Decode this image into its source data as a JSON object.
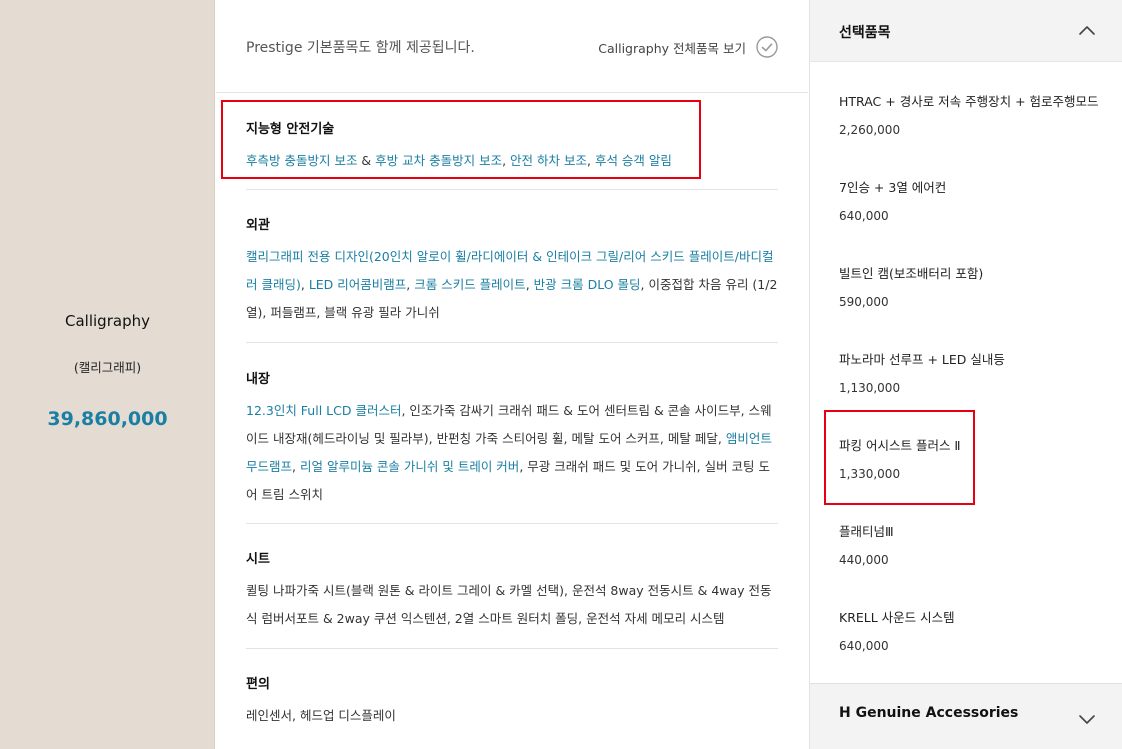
{
  "trim": {
    "name": "Calligraphy",
    "name_ko": "(캘리그래피)",
    "price": "39,860,000"
  },
  "main": {
    "note": "Prestige 기본품목도 함께 제공됩니다.",
    "view_all_label": "Calligraphy 전체품목 보기",
    "sections": [
      {
        "title": "지능형 안전기술",
        "segments": [
          {
            "text": "후측방 충돌방지 보조",
            "hl": true
          },
          {
            "text": " & ",
            "hl": false
          },
          {
            "text": "후방 교차 충돌방지 보조",
            "hl": true
          },
          {
            "text": ", ",
            "hl": false
          },
          {
            "text": "안전 하차 보조",
            "hl": true
          },
          {
            "text": ", ",
            "hl": false
          },
          {
            "text": "후석 승객 알림",
            "hl": true
          }
        ]
      },
      {
        "title": "외관",
        "segments": [
          {
            "text": "캘리그래피 전용 디자인(20인치 알로이 휠/라디에이터 & 인테이크 그릴/리어 스키드 플레이트/",
            "hl": true
          },
          {
            "text": "바디컬러 클래딩)",
            "hl": true
          },
          {
            "text": ", ",
            "hl": false
          },
          {
            "text": "LED 리어콤비램프",
            "hl": true
          },
          {
            "text": ", ",
            "hl": false
          },
          {
            "text": "크롬 스키드 플레이트",
            "hl": true
          },
          {
            "text": ", ",
            "hl": false
          },
          {
            "text": "반광 크롬 DLO 몰딩",
            "hl": true
          },
          {
            "text": ", 이중접합 차음 유리 (1/2열), 퍼들램프, 블랙 유광 필라 가니쉬",
            "hl": false
          }
        ]
      },
      {
        "title": "내장",
        "segments": [
          {
            "text": "12.3인치 Full LCD 클러스터",
            "hl": true
          },
          {
            "text": ", 인조가죽 감싸기 크래쉬 패드 & 도어 센터트림 & 콘솔 사이드부, 스웨이드 내장재(헤드라이닝 및 필라부), 반펀칭 가죽 스티어링 휠, 메탈 도어 스커프, 메탈 페달, ",
            "hl": false
          },
          {
            "text": "앰비언트 무드램프",
            "hl": true
          },
          {
            "text": ", ",
            "hl": false
          },
          {
            "text": "리얼 알루미늄 콘솔 가니쉬 및 트레이 커버",
            "hl": true
          },
          {
            "text": ", 무광 크래쉬 패드 및 도어 가니쉬, 실버 코팅 도어 트림 스위치",
            "hl": false
          }
        ]
      },
      {
        "title": "시트",
        "segments": [
          {
            "text": "퀼팅 나파가죽 시트(블랙 원톤 & 라이트 그레이 & 카멜 선택), 운전석 8way 전동시트 & 4way 전동식 럼버서포트 & 2way 쿠션 익스텐션, 2열 스마트 원터치 폴딩, 운전석 자세 메모리 시스템",
            "hl": false
          }
        ]
      },
      {
        "title": "편의",
        "segments": [
          {
            "text": "레인센서, 헤드업 디스플레이",
            "hl": false
          }
        ]
      }
    ]
  },
  "options": {
    "title": "선택품목",
    "items": [
      {
        "name": "HTRAC + 경사로 저속 주행장치 + 험로주행모드",
        "price": "2,260,000"
      },
      {
        "name": "7인승 + 3열 에어컨",
        "price": "640,000"
      },
      {
        "name": "빌트인 캠(보조배터리 포함)",
        "price": "590,000"
      },
      {
        "name": "파노라마 선루프 + LED 실내등",
        "price": "1,130,000"
      },
      {
        "name": "파킹 어시스트 플러스 Ⅱ",
        "price": "1,330,000"
      },
      {
        "name": "플래티넘Ⅲ",
        "price": "440,000"
      },
      {
        "name": "KRELL 사운드 시스템",
        "price": "640,000"
      }
    ],
    "accessories_title": "H Genuine Accessories"
  },
  "colors": {
    "accent": "#1a7fa2",
    "highlight_box": "#e60012",
    "trim_panel_bg": "#e4dcd3"
  }
}
